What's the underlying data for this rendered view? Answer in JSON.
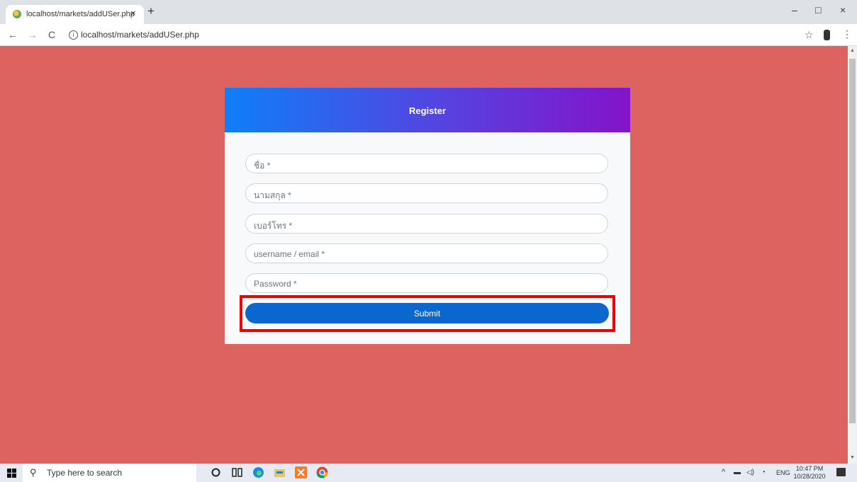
{
  "browser": {
    "tab_title": "localhost/markets/addUSer.php",
    "tab_close": "×",
    "new_tab": "+",
    "url": "localhost/markets/addUSer.php",
    "nav": {
      "back": "←",
      "forward": "→",
      "reload": "C",
      "info": "i"
    },
    "window_controls": {
      "minimize": "–",
      "maximize": "□",
      "close": "×"
    },
    "bookmark_star": "☆",
    "menu": "⋮"
  },
  "form": {
    "header_title": "Register",
    "fields": [
      {
        "placeholder": "ชื่อ *"
      },
      {
        "placeholder": "นามสกุล *"
      },
      {
        "placeholder": "เบอร์โทร *"
      },
      {
        "placeholder": "username / email *"
      },
      {
        "placeholder": "Password *"
      }
    ],
    "submit_label": "Submit"
  },
  "taskbar": {
    "search_placeholder": "Type here to search",
    "search_icon": "⚲",
    "tray_chevron": "^",
    "language": "ENG",
    "time": "10:47 PM",
    "date": "10/28/2020"
  },
  "colors": {
    "page_background": "#dd6360",
    "header_gradient_start": "#0f7ef8",
    "header_gradient_end": "#8413c9",
    "submit": "#0b66cd",
    "highlight": "#ee0000"
  }
}
